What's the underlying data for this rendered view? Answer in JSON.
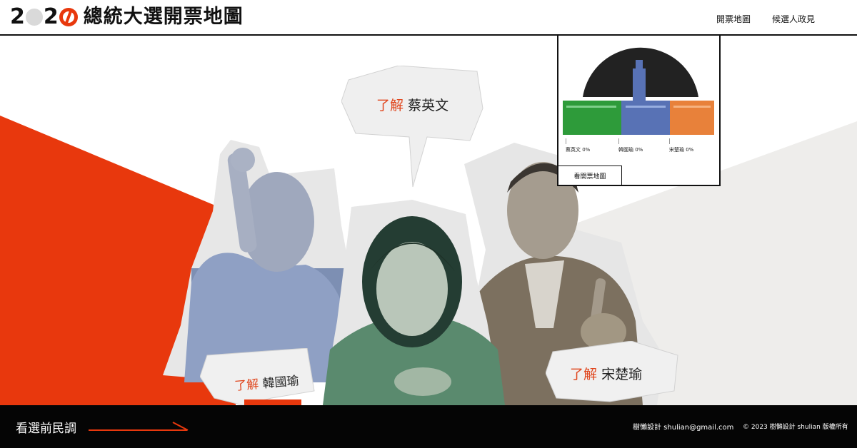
{
  "header": {
    "logo_year_digits": [
      "2",
      "2"
    ],
    "logo_title": "總統大選開票地圖",
    "nav": [
      "開票地圖",
      "候選人政見"
    ]
  },
  "hero": {
    "bubbles": [
      {
        "prefix": "了解",
        "name": "蔡英文"
      },
      {
        "prefix": "了解",
        "name": "韓國瑜"
      },
      {
        "prefix": "了解",
        "name": "宋楚瑜"
      }
    ]
  },
  "map_widget": {
    "candidates": [
      "蔡英文 0%",
      "韓國瑜 0%",
      "宋楚瑜 0%"
    ],
    "button": "看開票地圖",
    "colors": {
      "tsai": "#2e9b3a",
      "han": "#5872b5",
      "soong": "#e8813a"
    }
  },
  "footer": {
    "poll_link": "看選前民調",
    "contact": "樹懶設計 shulian@gmail.com",
    "copyright": "© 2023 樹懶設計 shulian 版權所有"
  },
  "colors": {
    "accent": "#e8380d",
    "dark": "#050505"
  }
}
